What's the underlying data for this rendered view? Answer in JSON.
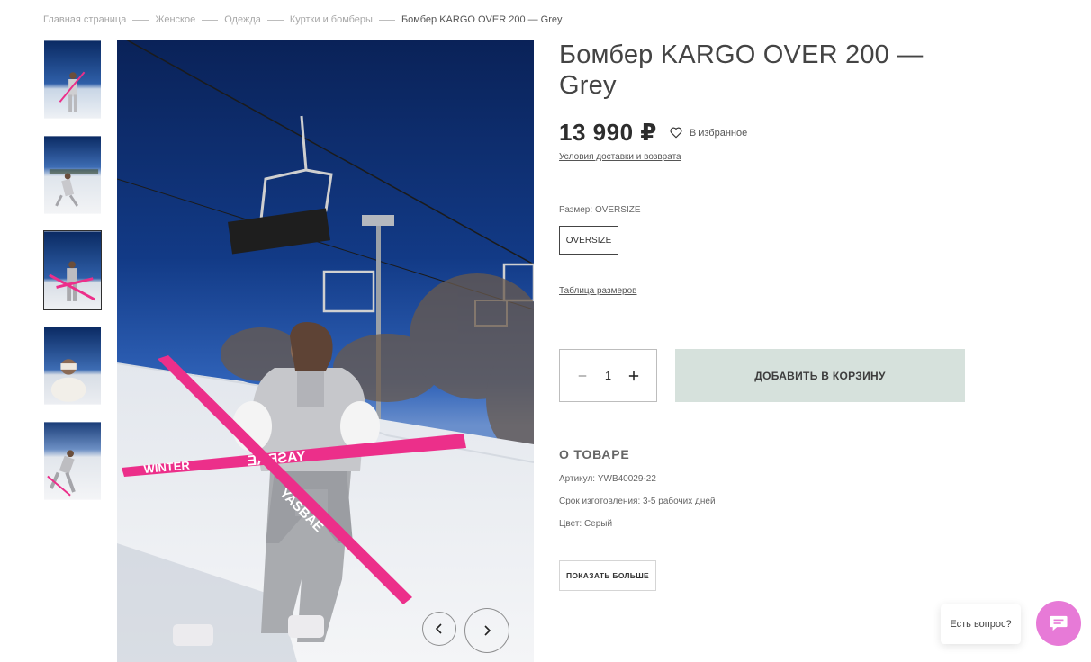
{
  "breadcrumb": {
    "items": [
      "Главная страница",
      "Женское",
      "Одежда",
      "Куртки и бомберы"
    ],
    "current": "Бомбер KARGO OVER 200 — Grey"
  },
  "product": {
    "title": "Бомбер KARGO OVER 200 — Grey",
    "price": "13 990 ₽",
    "favorite_label": "В избранное",
    "delivery_link": "Условия доставки и возврата",
    "size_caption_label": "Размер:",
    "size_caption_value": "OVERSIZE",
    "size_option": "OVERSIZE",
    "size_table_link": "Таблица размеров",
    "quantity": "1",
    "add_to_cart": "ДОБАВИТЬ В КОРЗИНУ"
  },
  "about": {
    "title": "О ТОВАРЕ",
    "lines": [
      "Артикул: YWB40029-22",
      "Срок изготовления: 3-5 рабочих дней",
      "Цвет: Серый"
    ],
    "more_button": "ПОКАЗАТЬ БОЛЬШЕ"
  },
  "photo": {
    "ski_text_left": "WINTER",
    "ski_text_right": "YASBAE",
    "boot_text": "YASBAE"
  },
  "gallery": {
    "active_index": 2,
    "thumbnail_count": 5
  },
  "chat": {
    "bubble_text": "Есть вопрос?"
  },
  "colors": {
    "accent_button": "#d6e1dc",
    "chat_button": "#e77ad7",
    "sky": "#0c2a63",
    "ski_pink": "#ec2f8a"
  },
  "icons": {
    "favorite": "heart-icon",
    "minus": "minus-icon",
    "plus": "plus-icon",
    "prev": "chevron-left-icon",
    "next": "chevron-right-icon",
    "chat": "chat-icon"
  }
}
